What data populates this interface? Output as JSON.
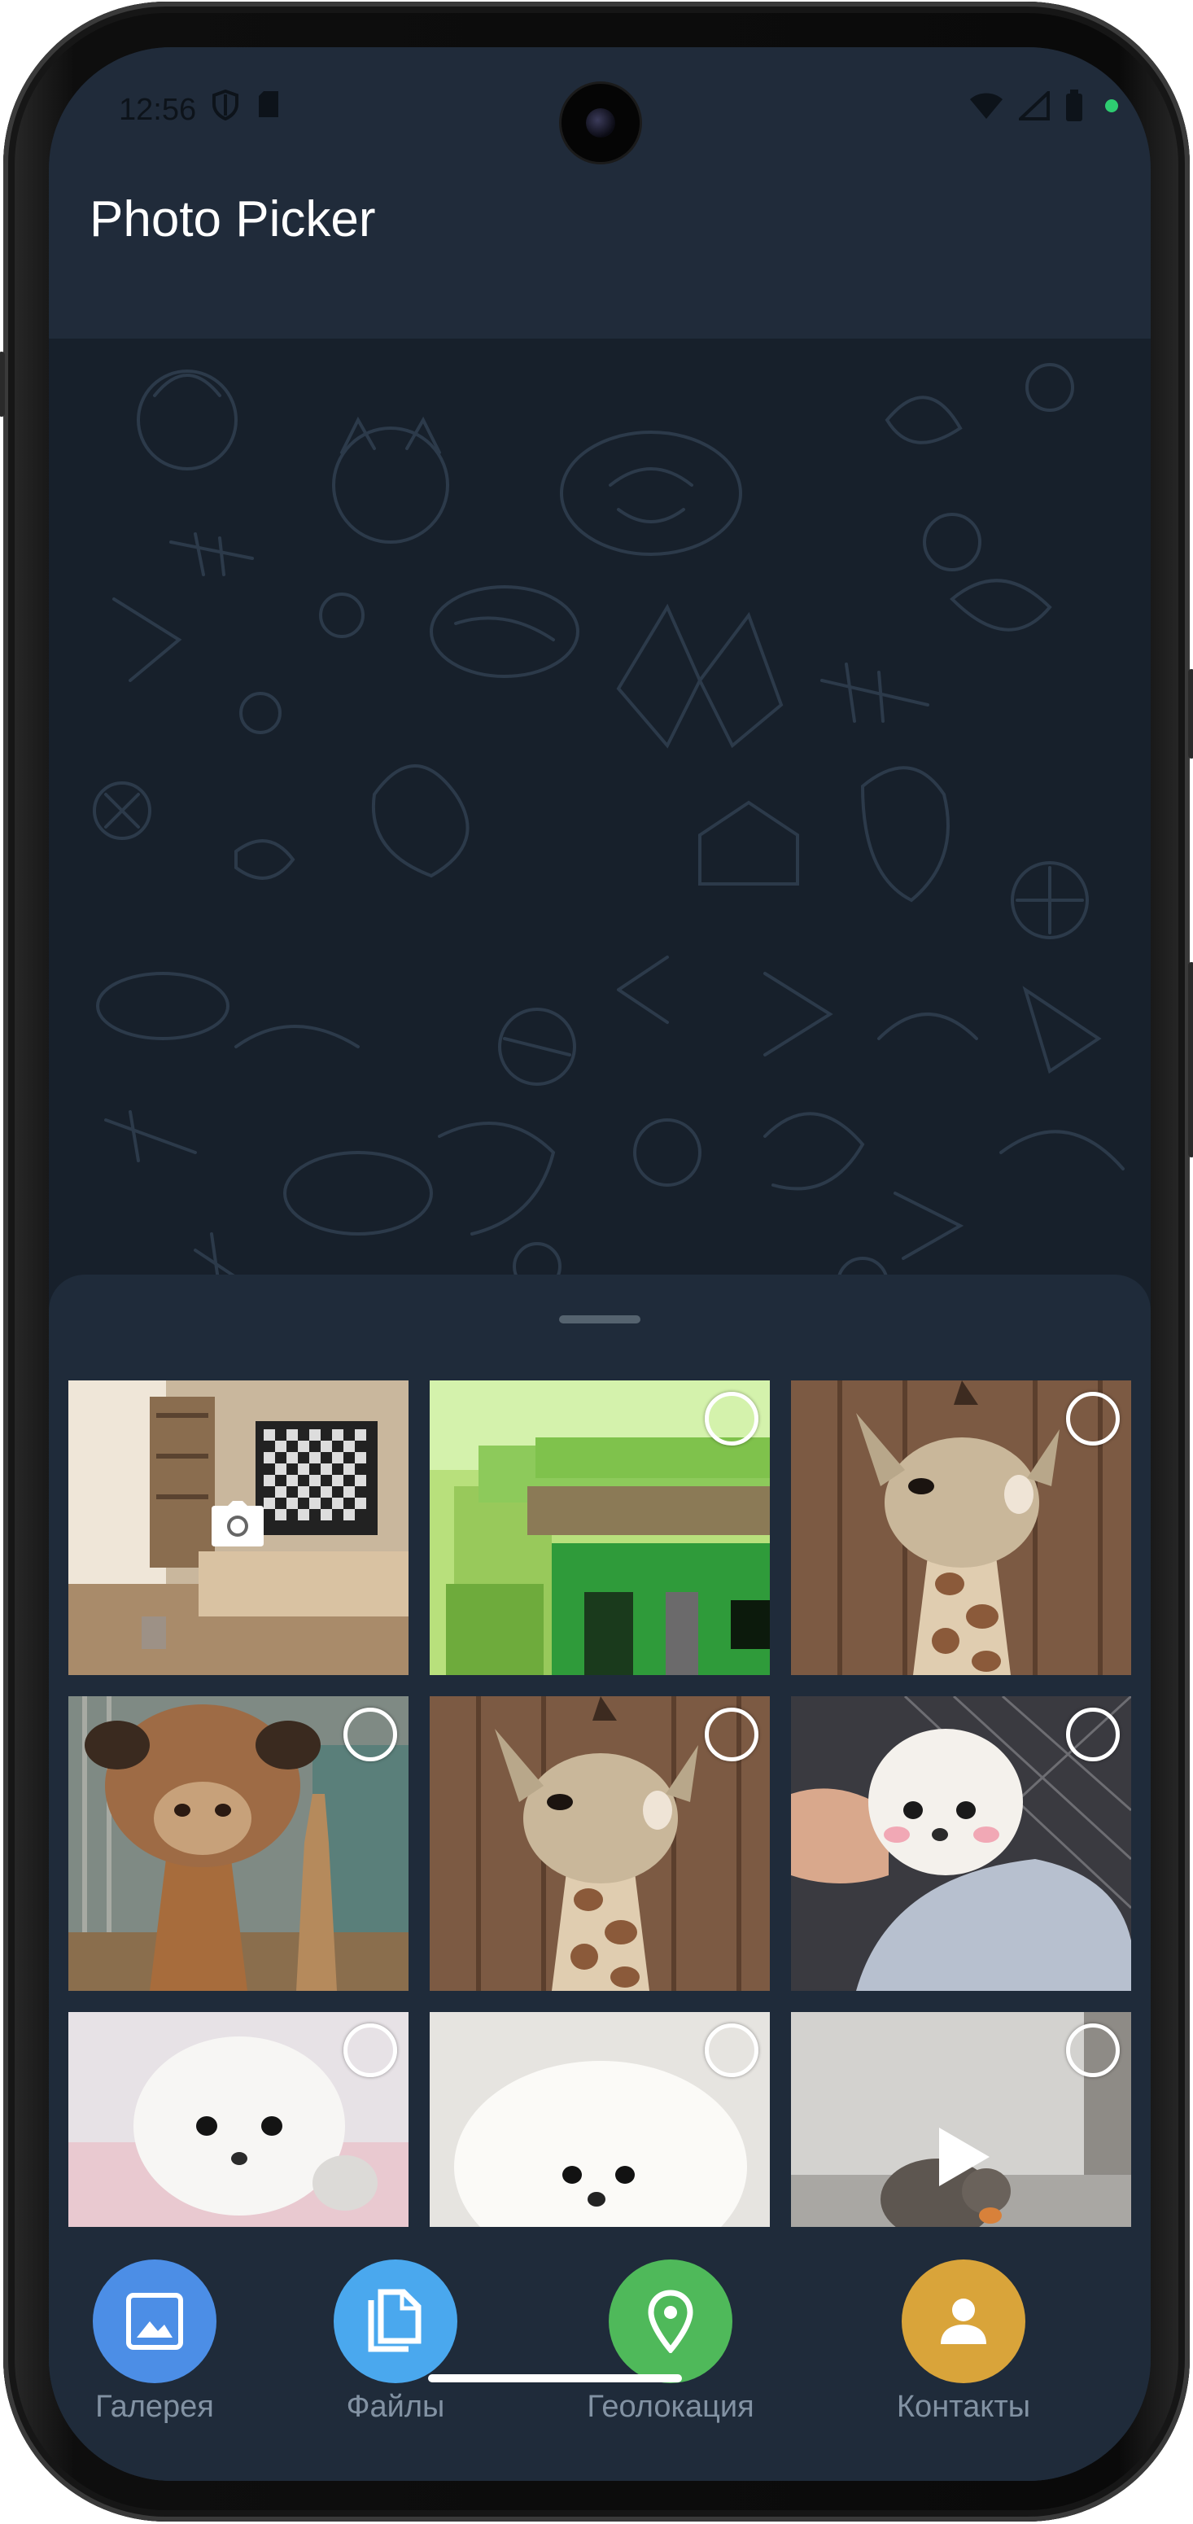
{
  "status_bar": {
    "time": "12:56",
    "left_icons": [
      "shield-icon",
      "sim-card-icon"
    ],
    "right_icons": [
      "wifi-icon",
      "signal-icon",
      "battery-icon"
    ],
    "notification_dot_color": "#2ecc71"
  },
  "app_bar": {
    "title": "Photo Picker"
  },
  "gallery": {
    "tiles": [
      {
        "id": "camera",
        "kind": "camera-preview",
        "selectable": false
      },
      {
        "id": "pixel-house",
        "kind": "image",
        "selectable": true
      },
      {
        "id": "giraffe-1",
        "kind": "image",
        "selectable": true
      },
      {
        "id": "giraffe-closeup",
        "kind": "image",
        "selectable": true
      },
      {
        "id": "giraffe-2",
        "kind": "image",
        "selectable": true
      },
      {
        "id": "pomeranian-hand",
        "kind": "image",
        "selectable": true
      },
      {
        "id": "pomeranian-puppy",
        "kind": "image",
        "selectable": true
      },
      {
        "id": "fluffy-dog",
        "kind": "image",
        "selectable": true
      },
      {
        "id": "video-cat",
        "kind": "video",
        "selectable": true
      }
    ]
  },
  "bottom_bar": {
    "items": [
      {
        "label": "Галерея",
        "icon": "image-icon",
        "color": "#4c8ee6"
      },
      {
        "label": "Файлы",
        "icon": "file-icon",
        "color": "#4aa8ee"
      },
      {
        "label": "Геолокация",
        "icon": "location-pin-icon",
        "color": "#4fb95a"
      },
      {
        "label": "Контакты",
        "icon": "person-icon",
        "color": "#d9a43a"
      }
    ]
  },
  "colors": {
    "background": "#17212b",
    "surface": "#1f2b3a",
    "text_primary": "#ffffff",
    "text_secondary": "#8292a3"
  }
}
